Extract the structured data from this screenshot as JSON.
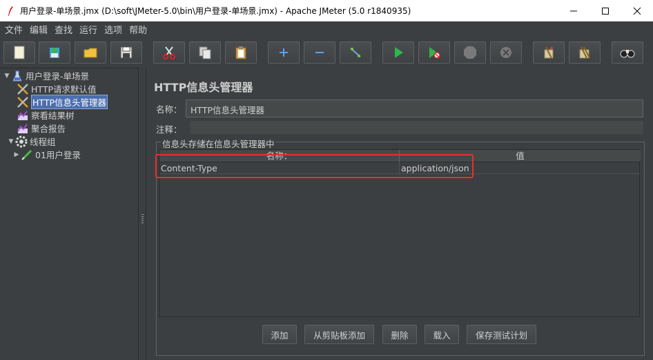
{
  "window": {
    "title": "用户登录-单场景.jmx (D:\\soft\\JMeter-5.0\\bin\\用户登录-单场景.jmx) - Apache JMeter (5.0 r1840935)",
    "minimize": "—",
    "maximize": "☐",
    "close": "✕"
  },
  "menu": {
    "items": [
      "文件",
      "编辑",
      "查找",
      "运行",
      "选项",
      "帮助"
    ]
  },
  "toolbar": {
    "buttons": [
      {
        "icon": "new-icon"
      },
      {
        "icon": "templates-icon"
      },
      {
        "icon": "open-icon"
      },
      {
        "icon": "save-icon"
      },
      {
        "icon": "cut-icon"
      },
      {
        "icon": "copy-icon"
      },
      {
        "icon": "paste-icon"
      },
      {
        "icon": "expand-icon"
      },
      {
        "icon": "collapse-icon"
      },
      {
        "icon": "toggle-icon"
      },
      {
        "icon": "start-icon"
      },
      {
        "icon": "start-no-timers-icon"
      },
      {
        "icon": "stop-icon"
      },
      {
        "icon": "shutdown-icon"
      },
      {
        "icon": "clear-icon"
      },
      {
        "icon": "clear-all-icon"
      },
      {
        "icon": "search-icon"
      }
    ]
  },
  "tree": {
    "items": [
      {
        "label": "用户登录-单场景",
        "icon": "test-plan-icon"
      },
      {
        "label": "HTTP请求默认值",
        "icon": "config-element-icon"
      },
      {
        "label": "HTTP信息头管理器",
        "icon": "config-element-icon"
      },
      {
        "label": "察看结果树",
        "icon": "listener-icon"
      },
      {
        "label": "聚合报告",
        "icon": "listener-icon"
      },
      {
        "label": "线程组",
        "icon": "thread-group-icon"
      },
      {
        "label": "01用户登录",
        "icon": "sampler-icon"
      }
    ]
  },
  "panel": {
    "title": "HTTP信息头管理器",
    "name_label": "名称：",
    "name_value": "HTTP信息头管理器",
    "comment_label": "注释：",
    "group_title": "信息头存储在信息头管理器中",
    "table": {
      "headers": [
        "名称：",
        "值"
      ],
      "rows": [
        {
          "name": "Content-Type",
          "value": "application/json"
        }
      ]
    },
    "buttons": {
      "add": "添加",
      "add_from_clipboard": "从剪贴板添加",
      "delete": "删除",
      "load": "载入",
      "save_test_plan": "保存测试计划"
    }
  },
  "colors": {
    "background": "#3c3f41",
    "selection": "#4b6eaf",
    "highlight_box": "#e8302a",
    "run_green": "#2fb54a"
  }
}
